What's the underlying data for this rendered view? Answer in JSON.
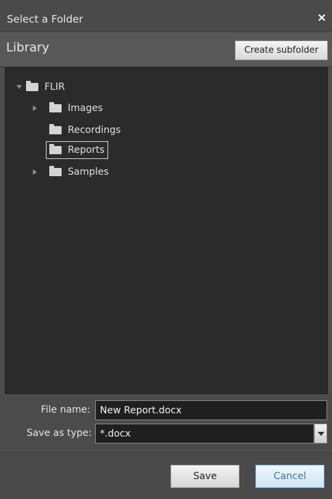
{
  "dialog": {
    "title": "Select a Folder",
    "close_glyph": "×"
  },
  "library": {
    "title": "Library",
    "create_subfolder_label": "Create subfolder"
  },
  "tree": {
    "root": {
      "label": "FLIR",
      "expanded": true
    },
    "children": [
      {
        "label": "Images",
        "has_children": true,
        "selected": false
      },
      {
        "label": "Recordings",
        "has_children": false,
        "selected": false
      },
      {
        "label": "Reports",
        "has_children": false,
        "selected": true
      },
      {
        "label": "Samples",
        "has_children": true,
        "selected": false
      }
    ]
  },
  "file": {
    "name_label": "File name:",
    "name_value": "New Report.docx",
    "type_label": "Save as type:",
    "type_value": "*.docx"
  },
  "buttons": {
    "save": "Save",
    "cancel": "Cancel"
  },
  "icons": {
    "folder": "folder-icon",
    "expand_arrow": "expand-arrow-icon",
    "collapse_arrow": "collapse-arrow-icon",
    "dropdown": "chevron-down-icon"
  },
  "colors": {
    "dialog_bg": "#4d4d4d",
    "tree_bg": "#2b2b2b",
    "cancel_accent": "#6aa7d8"
  }
}
